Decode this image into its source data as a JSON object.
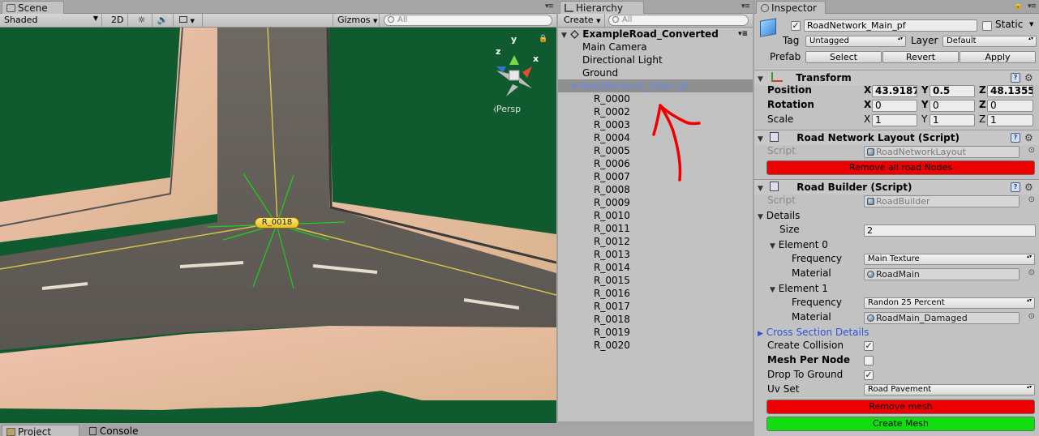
{
  "scene": {
    "tab_title": "Scene",
    "shading_mode": "Shaded",
    "mode_2d": "2D",
    "gizmos_label": "Gizmos",
    "search_placeholder": "All",
    "persp_label": "Persp",
    "axis_y": "y",
    "axis_x": "x",
    "axis_z": "z",
    "node_label": "R_0018",
    "icons": [
      "sun-icon",
      "speaker-icon",
      "image-icon"
    ]
  },
  "bottom_tabs": {
    "project": "Project",
    "console": "Console"
  },
  "hierarchy": {
    "tab_title": "Hierarchy",
    "create_label": "Create",
    "search_placeholder": "All",
    "root": "ExampleRoad_Converted",
    "items": [
      "Main Camera",
      "Directional Light",
      "Ground"
    ],
    "selected": "RoadNetwork_Main_pf",
    "children": [
      "R_0000",
      "R_0002",
      "R_0003",
      "R_0004",
      "R_0005",
      "R_0006",
      "R_0007",
      "R_0008",
      "R_0009",
      "R_0010",
      "R_0011",
      "R_0012",
      "R_0013",
      "R_0014",
      "R_0015",
      "R_0016",
      "R_0017",
      "R_0018",
      "R_0019",
      "R_0020"
    ]
  },
  "inspector": {
    "tab_title": "Inspector",
    "object_name": "RoadNetwork_Main_pf",
    "static_label": "Static",
    "tag_label": "Tag",
    "tag_value": "Untagged",
    "layer_label": "Layer",
    "layer_value": "Default",
    "prefab_label": "Prefab",
    "select_label": "Select",
    "revert_label": "Revert",
    "apply_label": "Apply",
    "transform": {
      "title": "Transform",
      "position_label": "Position",
      "rotation_label": "Rotation",
      "scale_label": "Scale",
      "x": "X",
      "y": "Y",
      "z": "Z",
      "position": [
        "43.9187",
        "0.5",
        "48.1355"
      ],
      "rotation": [
        "0",
        "0",
        "0"
      ],
      "scale": [
        "1",
        "1",
        "1"
      ]
    },
    "layout_script": {
      "title": "Road Network Layout (Script)",
      "script_label": "Script",
      "script_value": "RoadNetworkLayout",
      "remove_nodes": "Remove all road Nodes"
    },
    "builder": {
      "title": "Road Builder (Script)",
      "script_label": "Script",
      "script_value": "RoadBuilder",
      "details_label": "Details",
      "size_label": "Size",
      "size_value": "2",
      "element0_label": "Element 0",
      "element1_label": "Element 1",
      "frequency_label": "Frequency",
      "material_label": "Material",
      "element0_frequency": "Main Texture",
      "element0_material": "RoadMain",
      "element1_frequency": "Randon 25 Percent",
      "element1_material": "RoadMain_Damaged",
      "cross_section": "Cross Section Details",
      "create_collision_label": "Create Collision",
      "mesh_per_node_label": "Mesh Per Node",
      "drop_to_ground_label": "Drop To Ground",
      "uv_set_label": "Uv Set",
      "uv_set_value": "Road Pavement",
      "remove_mesh": "Remove mesh",
      "create_mesh": "Create Mesh"
    },
    "colors": {
      "red_button": "#ee0000",
      "green_button": "#11dd11",
      "link_blue": "#2a55d8"
    }
  }
}
